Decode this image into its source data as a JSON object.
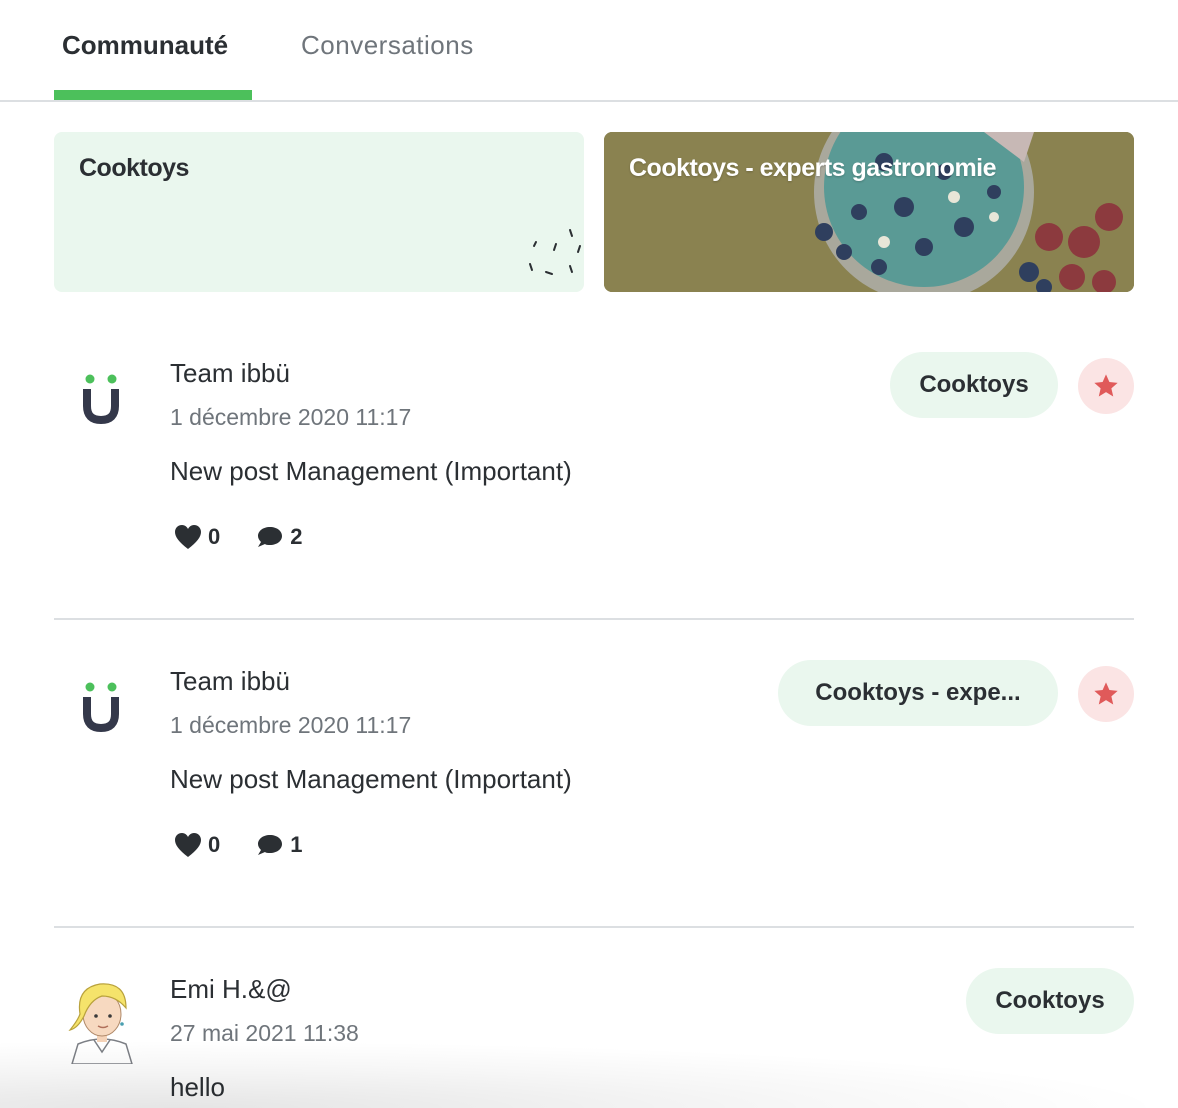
{
  "tabs": [
    {
      "label": "Communauté",
      "active": true
    },
    {
      "label": "Conversations",
      "active": false
    }
  ],
  "communities": [
    {
      "title": "Cooktoys"
    },
    {
      "title": "Cooktoys - experts gastronomie"
    }
  ],
  "posts": [
    {
      "author": "Team ibbü",
      "date": "1 décembre 2020 11:17",
      "content": "New post Management (Important)",
      "likes": "0",
      "comments": "2",
      "community": "Cooktoys",
      "starred": true
    },
    {
      "author": "Team ibbü",
      "date": "1 décembre 2020 11:17",
      "content": "New post Management (Important)",
      "likes": "0",
      "comments": "1",
      "community": "Cooktoys - expe...",
      "starred": true
    },
    {
      "author": "Emi H.&@",
      "date": "27 mai 2021 11:38",
      "content": "hello",
      "community": "Cooktoys",
      "starred": false
    }
  ],
  "colors": {
    "accent": "#4cc05b",
    "pill_bg": "#eaf7ee",
    "star": "#e05a5a",
    "star_bg": "#fbe4e4"
  }
}
